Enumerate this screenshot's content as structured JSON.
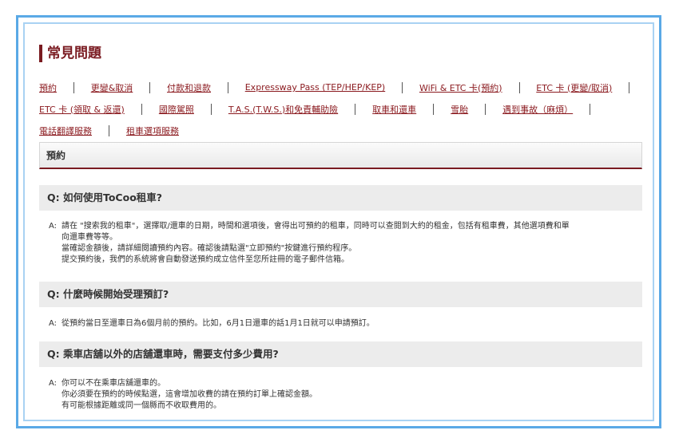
{
  "page_title": "常見問題",
  "nav_rows": [
    [
      "預約",
      "更變&取消",
      "付款和退款",
      "Expressway Pass (TEP/HEP/KEP)",
      "WiFi & ETC 卡(預約)",
      "ETC 卡 (更變/取消)"
    ],
    [
      "ETC 卡 (領取 & 返還)",
      "國際駕照",
      "T.A.S.(T.W.S.)和免責輔助險",
      "取車和還車",
      "雪胎",
      "遇到事故（麻煩）"
    ],
    [
      "電話翻譯服務",
      "租車選項服務"
    ]
  ],
  "section_title": "預約",
  "faq": [
    {
      "question": "Q: 如何使用ToCoo租車?",
      "answer_label": "A:",
      "answer_lines": [
        "請在 \"搜索我的租車\"，選擇取/還車的日期，時間和選項後，會得出可預約的租車，同時可以查閱到大約的租金，包括有租車費，其他選項費和單",
        "向還車費等等。",
        "當確認金額後，請詳細閱讀預約內容。確認後請點選\"立即預約\"按鍵進行預約程序。",
        "提交預約後，我們的系統將會自動發送預約成立信件至您所註冊的電子郵件信箱。"
      ]
    },
    {
      "question": "Q: 什麼時候開始受理預訂?",
      "answer_label": "A:",
      "answer_lines": [
        "從預約當日至還車日為6個月前的預約。比如，6月1日還車的話1月1日就可以申請預訂。"
      ]
    },
    {
      "question": "Q: 乘車店舖以外的店舖還車時，需要支付多少費用?",
      "answer_label": "A:",
      "answer_lines": [
        "你可以不在乘車店舖還車的。",
        "你必須要在預約的時候點選，這會增加收費的請在預約訂單上確認金額。",
        "有可能根據距離或同一個縣而不收取費用的。"
      ]
    }
  ]
}
